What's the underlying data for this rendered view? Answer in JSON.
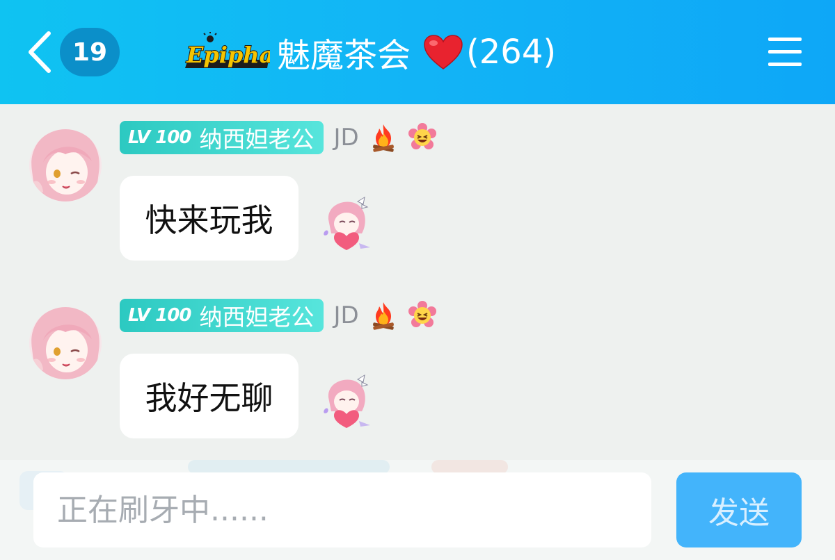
{
  "header": {
    "unread_count": "19",
    "logo_text": "Epiphany",
    "group_name": "魅魔茶会",
    "member_count": "(264)",
    "colors": {
      "gradient_start": "#0fc3f2",
      "gradient_end": "#0ea7f7",
      "badge": "#0b8fc9"
    },
    "icons": {
      "back": "chevron-left-icon",
      "heart": "red-heart-emoji",
      "menu": "hamburger-menu-icon"
    }
  },
  "messages": [
    {
      "level": "LV 100",
      "nickname": "纳西妲老公",
      "tag": "JD",
      "badges": [
        "fire-icon",
        "laughing-flower-icon"
      ],
      "text": "快来玩我",
      "sticker": "pink-hair-girl-heart-sticker"
    },
    {
      "level": "LV 100",
      "nickname": "纳西妲老公",
      "tag": "JD",
      "badges": [
        "fire-icon",
        "laughing-flower-icon"
      ],
      "text": "我好无聊",
      "sticker": "pink-hair-girl-heart-sticker"
    }
  ],
  "composer": {
    "placeholder": "正在刷牙中......",
    "value": "",
    "send_label": "发送",
    "send_color": "#43b4fb"
  }
}
